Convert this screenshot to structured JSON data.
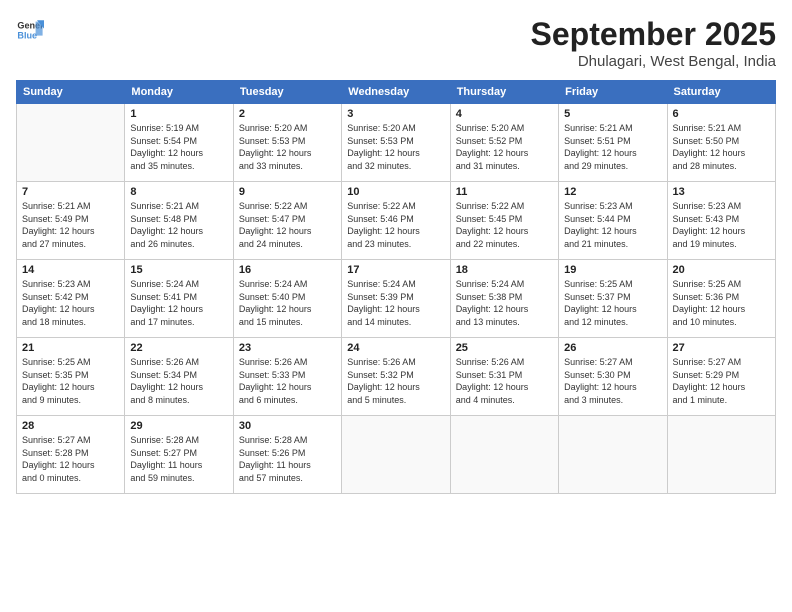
{
  "header": {
    "logo": {
      "line1": "General",
      "line2": "Blue"
    },
    "month": "September 2025",
    "location": "Dhulagari, West Bengal, India"
  },
  "weekdays": [
    "Sunday",
    "Monday",
    "Tuesday",
    "Wednesday",
    "Thursday",
    "Friday",
    "Saturday"
  ],
  "weeks": [
    [
      {
        "day": "",
        "info": ""
      },
      {
        "day": "1",
        "info": "Sunrise: 5:19 AM\nSunset: 5:54 PM\nDaylight: 12 hours\nand 35 minutes."
      },
      {
        "day": "2",
        "info": "Sunrise: 5:20 AM\nSunset: 5:53 PM\nDaylight: 12 hours\nand 33 minutes."
      },
      {
        "day": "3",
        "info": "Sunrise: 5:20 AM\nSunset: 5:53 PM\nDaylight: 12 hours\nand 32 minutes."
      },
      {
        "day": "4",
        "info": "Sunrise: 5:20 AM\nSunset: 5:52 PM\nDaylight: 12 hours\nand 31 minutes."
      },
      {
        "day": "5",
        "info": "Sunrise: 5:21 AM\nSunset: 5:51 PM\nDaylight: 12 hours\nand 29 minutes."
      },
      {
        "day": "6",
        "info": "Sunrise: 5:21 AM\nSunset: 5:50 PM\nDaylight: 12 hours\nand 28 minutes."
      }
    ],
    [
      {
        "day": "7",
        "info": "Sunrise: 5:21 AM\nSunset: 5:49 PM\nDaylight: 12 hours\nand 27 minutes."
      },
      {
        "day": "8",
        "info": "Sunrise: 5:21 AM\nSunset: 5:48 PM\nDaylight: 12 hours\nand 26 minutes."
      },
      {
        "day": "9",
        "info": "Sunrise: 5:22 AM\nSunset: 5:47 PM\nDaylight: 12 hours\nand 24 minutes."
      },
      {
        "day": "10",
        "info": "Sunrise: 5:22 AM\nSunset: 5:46 PM\nDaylight: 12 hours\nand 23 minutes."
      },
      {
        "day": "11",
        "info": "Sunrise: 5:22 AM\nSunset: 5:45 PM\nDaylight: 12 hours\nand 22 minutes."
      },
      {
        "day": "12",
        "info": "Sunrise: 5:23 AM\nSunset: 5:44 PM\nDaylight: 12 hours\nand 21 minutes."
      },
      {
        "day": "13",
        "info": "Sunrise: 5:23 AM\nSunset: 5:43 PM\nDaylight: 12 hours\nand 19 minutes."
      }
    ],
    [
      {
        "day": "14",
        "info": "Sunrise: 5:23 AM\nSunset: 5:42 PM\nDaylight: 12 hours\nand 18 minutes."
      },
      {
        "day": "15",
        "info": "Sunrise: 5:24 AM\nSunset: 5:41 PM\nDaylight: 12 hours\nand 17 minutes."
      },
      {
        "day": "16",
        "info": "Sunrise: 5:24 AM\nSunset: 5:40 PM\nDaylight: 12 hours\nand 15 minutes."
      },
      {
        "day": "17",
        "info": "Sunrise: 5:24 AM\nSunset: 5:39 PM\nDaylight: 12 hours\nand 14 minutes."
      },
      {
        "day": "18",
        "info": "Sunrise: 5:24 AM\nSunset: 5:38 PM\nDaylight: 12 hours\nand 13 minutes."
      },
      {
        "day": "19",
        "info": "Sunrise: 5:25 AM\nSunset: 5:37 PM\nDaylight: 12 hours\nand 12 minutes."
      },
      {
        "day": "20",
        "info": "Sunrise: 5:25 AM\nSunset: 5:36 PM\nDaylight: 12 hours\nand 10 minutes."
      }
    ],
    [
      {
        "day": "21",
        "info": "Sunrise: 5:25 AM\nSunset: 5:35 PM\nDaylight: 12 hours\nand 9 minutes."
      },
      {
        "day": "22",
        "info": "Sunrise: 5:26 AM\nSunset: 5:34 PM\nDaylight: 12 hours\nand 8 minutes."
      },
      {
        "day": "23",
        "info": "Sunrise: 5:26 AM\nSunset: 5:33 PM\nDaylight: 12 hours\nand 6 minutes."
      },
      {
        "day": "24",
        "info": "Sunrise: 5:26 AM\nSunset: 5:32 PM\nDaylight: 12 hours\nand 5 minutes."
      },
      {
        "day": "25",
        "info": "Sunrise: 5:26 AM\nSunset: 5:31 PM\nDaylight: 12 hours\nand 4 minutes."
      },
      {
        "day": "26",
        "info": "Sunrise: 5:27 AM\nSunset: 5:30 PM\nDaylight: 12 hours\nand 3 minutes."
      },
      {
        "day": "27",
        "info": "Sunrise: 5:27 AM\nSunset: 5:29 PM\nDaylight: 12 hours\nand 1 minute."
      }
    ],
    [
      {
        "day": "28",
        "info": "Sunrise: 5:27 AM\nSunset: 5:28 PM\nDaylight: 12 hours\nand 0 minutes."
      },
      {
        "day": "29",
        "info": "Sunrise: 5:28 AM\nSunset: 5:27 PM\nDaylight: 11 hours\nand 59 minutes."
      },
      {
        "day": "30",
        "info": "Sunrise: 5:28 AM\nSunset: 5:26 PM\nDaylight: 11 hours\nand 57 minutes."
      },
      {
        "day": "",
        "info": ""
      },
      {
        "day": "",
        "info": ""
      },
      {
        "day": "",
        "info": ""
      },
      {
        "day": "",
        "info": ""
      }
    ]
  ]
}
